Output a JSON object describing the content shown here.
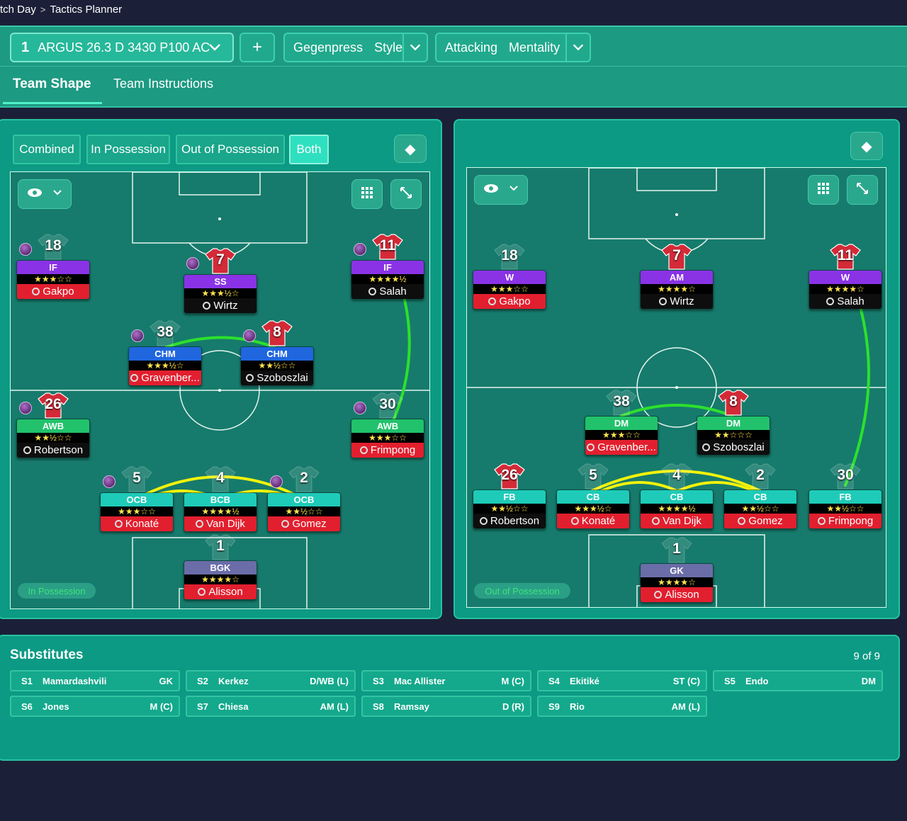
{
  "breadcrumb": {
    "parent": "tch Day",
    "current": "Tactics Planner"
  },
  "topbar": {
    "tactic_number": "1",
    "tactic_name": "ARGUS 26.3 D 3430 P100 AC",
    "add_label": "+",
    "style_value": "Gegenpress",
    "style_label": "Style",
    "mentality_value": "Attacking",
    "mentality_label": "Mentality"
  },
  "tabs": {
    "team_shape": "Team Shape",
    "team_instructions": "Team Instructions"
  },
  "modes": {
    "combined": "Combined",
    "in_possession": "In Possession",
    "out_of_possession": "Out of Possession",
    "both": "Both"
  },
  "pitch_labels": {
    "left": "In Possession",
    "right": "Out of Possession"
  },
  "left_players": [
    {
      "num": "18",
      "role": "IF",
      "stars": "★★★☆☆",
      "name": "Gakpo",
      "role_color": "purple",
      "name_color": "red"
    },
    {
      "num": "7",
      "role": "SS",
      "stars": "★★★½☆",
      "name": "Wirtz",
      "role_color": "purple",
      "name_color": "black"
    },
    {
      "num": "11",
      "role": "IF",
      "stars": "★★★★½",
      "name": "Salah",
      "role_color": "purple",
      "name_color": "black"
    },
    {
      "num": "38",
      "role": "CHM",
      "stars": "★★★½☆",
      "name": "Gravenber...",
      "role_color": "blue",
      "name_color": "red"
    },
    {
      "num": "8",
      "role": "CHM",
      "stars": "★★½☆☆",
      "name": "Szoboszlai",
      "role_color": "blue",
      "name_color": "black"
    },
    {
      "num": "26",
      "role": "AWB",
      "stars": "★★½☆☆",
      "name": "Robertson",
      "role_color": "green",
      "name_color": "black"
    },
    {
      "num": "30",
      "role": "AWB",
      "stars": "★★★☆☆",
      "name": "Frimpong",
      "role_color": "green",
      "name_color": "red"
    },
    {
      "num": "5",
      "role": "OCB",
      "stars": "★★★☆☆",
      "name": "Konaté",
      "role_color": "teal",
      "name_color": "red"
    },
    {
      "num": "4",
      "role": "BCB",
      "stars": "★★★★½",
      "name": "Van Dijk",
      "role_color": "teal",
      "name_color": "red"
    },
    {
      "num": "2",
      "role": "OCB",
      "stars": "★★½☆☆",
      "name": "Gomez",
      "role_color": "teal",
      "name_color": "red"
    },
    {
      "num": "1",
      "role": "BGK",
      "stars": "★★★★☆",
      "name": "Alisson",
      "role_color": "slate",
      "name_color": "red"
    }
  ],
  "right_players": [
    {
      "num": "18",
      "role": "W",
      "stars": "★★★☆☆",
      "name": "Gakpo",
      "role_color": "purple",
      "name_color": "red"
    },
    {
      "num": "7",
      "role": "AM",
      "stars": "★★★★☆",
      "name": "Wirtz",
      "role_color": "purple",
      "name_color": "black"
    },
    {
      "num": "11",
      "role": "W",
      "stars": "★★★★☆",
      "name": "Salah",
      "role_color": "purple",
      "name_color": "black"
    },
    {
      "num": "38",
      "role": "DM",
      "stars": "★★★☆☆",
      "name": "Gravenber...",
      "role_color": "green",
      "name_color": "red"
    },
    {
      "num": "8",
      "role": "DM",
      "stars": "★★☆☆☆",
      "name": "Szoboszlai",
      "role_color": "green",
      "name_color": "black"
    },
    {
      "num": "26",
      "role": "FB",
      "stars": "★★½☆☆",
      "name": "Robertson",
      "role_color": "teal",
      "name_color": "black"
    },
    {
      "num": "5",
      "role": "CB",
      "stars": "★★★½☆",
      "name": "Konaté",
      "role_color": "teal",
      "name_color": "red"
    },
    {
      "num": "4",
      "role": "CB",
      "stars": "★★★★½",
      "name": "Van Dijk",
      "role_color": "teal",
      "name_color": "red"
    },
    {
      "num": "2",
      "role": "CB",
      "stars": "★★½☆☆",
      "name": "Gomez",
      "role_color": "teal",
      "name_color": "red"
    },
    {
      "num": "30",
      "role": "FB",
      "stars": "★★½☆☆",
      "name": "Frimpong",
      "role_color": "teal",
      "name_color": "red"
    },
    {
      "num": "1",
      "role": "GK",
      "stars": "★★★★☆",
      "name": "Alisson",
      "role_color": "slate",
      "name_color": "red"
    }
  ],
  "substitutes": {
    "title": "Substitutes",
    "count": "9 of 9",
    "items": [
      {
        "id": "S1",
        "name": "Mamardashvili",
        "pos": "GK"
      },
      {
        "id": "S2",
        "name": "Kerkez",
        "pos": "D/WB (L)"
      },
      {
        "id": "S3",
        "name": "Mac Allister",
        "pos": "M (C)"
      },
      {
        "id": "S4",
        "name": "Ekitiké",
        "pos": "ST (C)"
      },
      {
        "id": "S5",
        "name": "Endo",
        "pos": "DM"
      },
      {
        "id": "S6",
        "name": "Jones",
        "pos": "M (C)"
      },
      {
        "id": "S7",
        "name": "Chiesa",
        "pos": "AM (L)"
      },
      {
        "id": "S8",
        "name": "Ramsay",
        "pos": "D (R)"
      },
      {
        "id": "S9",
        "name": "Rio",
        "pos": "AM (L)"
      }
    ]
  },
  "colors": {
    "accent": "#3ed1ae",
    "panel": "#0c9a84",
    "pitch": "#167b6c",
    "link_green": "#2de02d",
    "link_yellow": "#f2f20a"
  }
}
